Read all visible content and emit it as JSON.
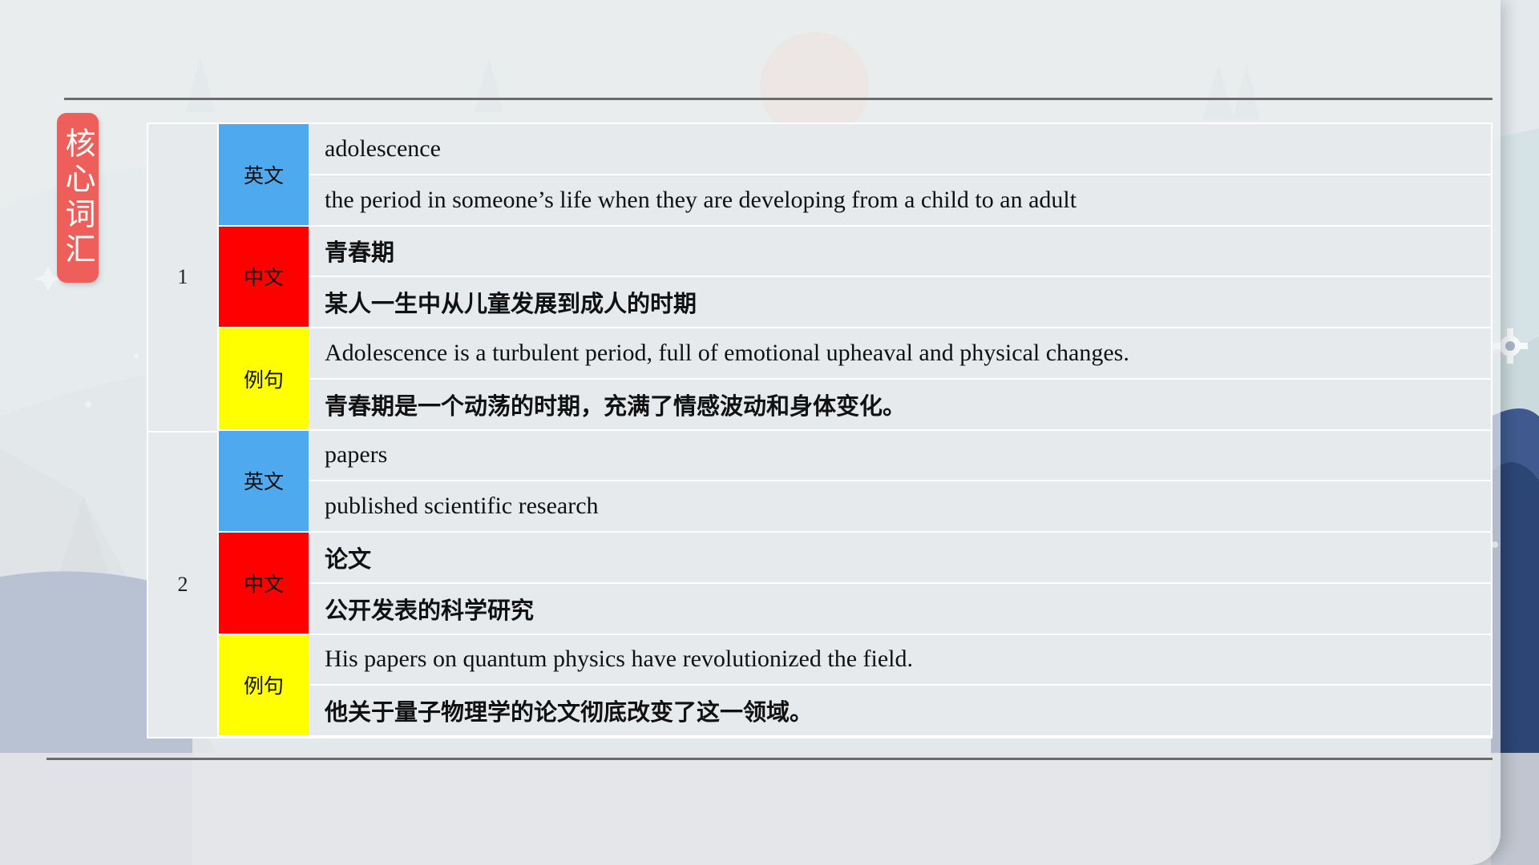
{
  "side_tag": {
    "text": "核心词汇"
  },
  "colors": {
    "english_label": "#4ea9ef",
    "chinese_label": "#ff0000",
    "example_label": "#ffff00",
    "side_tag": "#ee5f5b"
  },
  "labels": {
    "english": "英文",
    "chinese": "中文",
    "example": "例句"
  },
  "entries": [
    {
      "number": "1",
      "english_word": "adolescence",
      "english_definition": "the period in someone’s life when they are developing from a child to an adult",
      "chinese_word": "青春期",
      "chinese_definition": "某人一生中从儿童发展到成人的时期",
      "example_english": "Adolescence is a turbulent period, full of emotional upheaval and physical changes.",
      "example_chinese": "青春期是一个动荡的时期，充满了情感波动和身体变化。"
    },
    {
      "number": "2",
      "english_word": "papers",
      "english_definition": "published scientific research",
      "chinese_word": "论文",
      "chinese_definition": "公开发表的科学研究",
      "example_english": "His papers on quantum physics have revolutionized the field.",
      "example_chinese": "他关于量子物理学的论文彻底改变了这一领域。"
    }
  ]
}
